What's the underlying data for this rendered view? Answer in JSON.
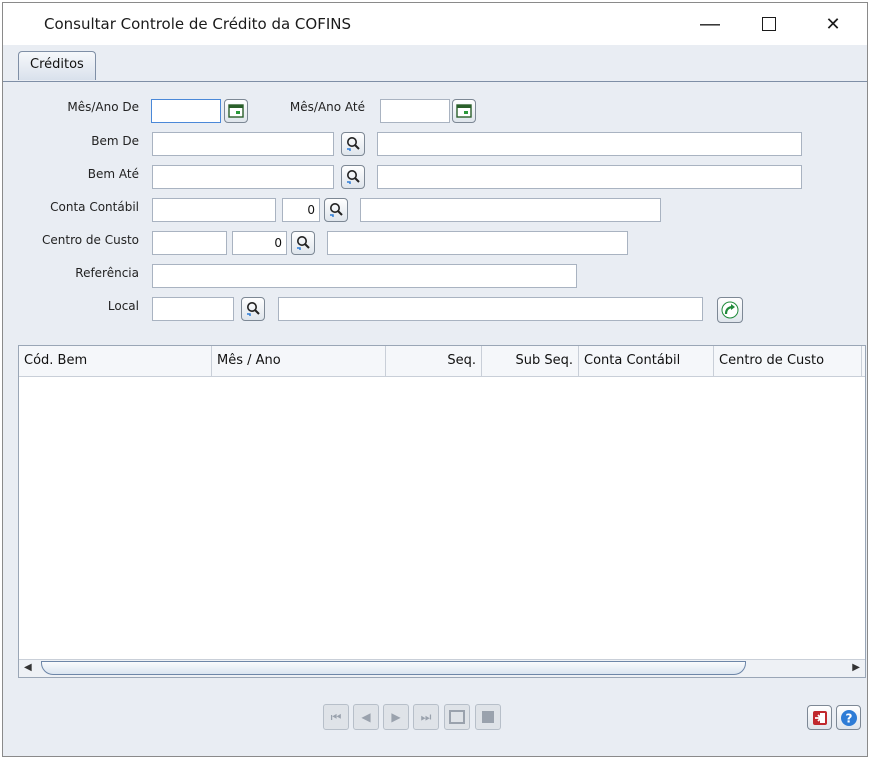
{
  "window": {
    "title": "Consultar Controle de Crédito da COFINS",
    "minimize": "—",
    "maximize": "☐",
    "close": "✕"
  },
  "tabs": [
    {
      "label": "Créditos"
    }
  ],
  "filters": {
    "mes_ano_de": {
      "label": "Mês/Ano De",
      "value": ""
    },
    "mes_ano_ate": {
      "label": "Mês/Ano Até",
      "value": ""
    },
    "bem_de": {
      "label": "Bem De",
      "value": "",
      "description": ""
    },
    "bem_ate": {
      "label": "Bem Até",
      "value": "",
      "description": ""
    },
    "conta_contabil": {
      "label": "Conta Contábil",
      "value": "",
      "digit": "0",
      "description": ""
    },
    "centro_de_custo": {
      "label": "Centro de Custo",
      "value": "",
      "digit": "0",
      "description": ""
    },
    "referencia": {
      "label": "Referência",
      "value": ""
    },
    "local": {
      "label": "Local",
      "value": "",
      "description": ""
    }
  },
  "grid": {
    "columns": [
      "Cód. Bem",
      "Mês / Ano",
      "Seq.",
      "Sub Seq.",
      "Conta Contábil",
      "Centro de Custo"
    ],
    "rows": []
  },
  "icons": {
    "calendar": "calendar-icon",
    "search": "search-icon",
    "refresh": "refresh-arrow-icon",
    "exit": "exit-icon",
    "help": "help-icon"
  },
  "colors": {
    "window_bg": "#e9edf3",
    "accent": "#2e7cd6",
    "exit_red": "#c0282d",
    "refresh_green": "#1f8a3a"
  }
}
